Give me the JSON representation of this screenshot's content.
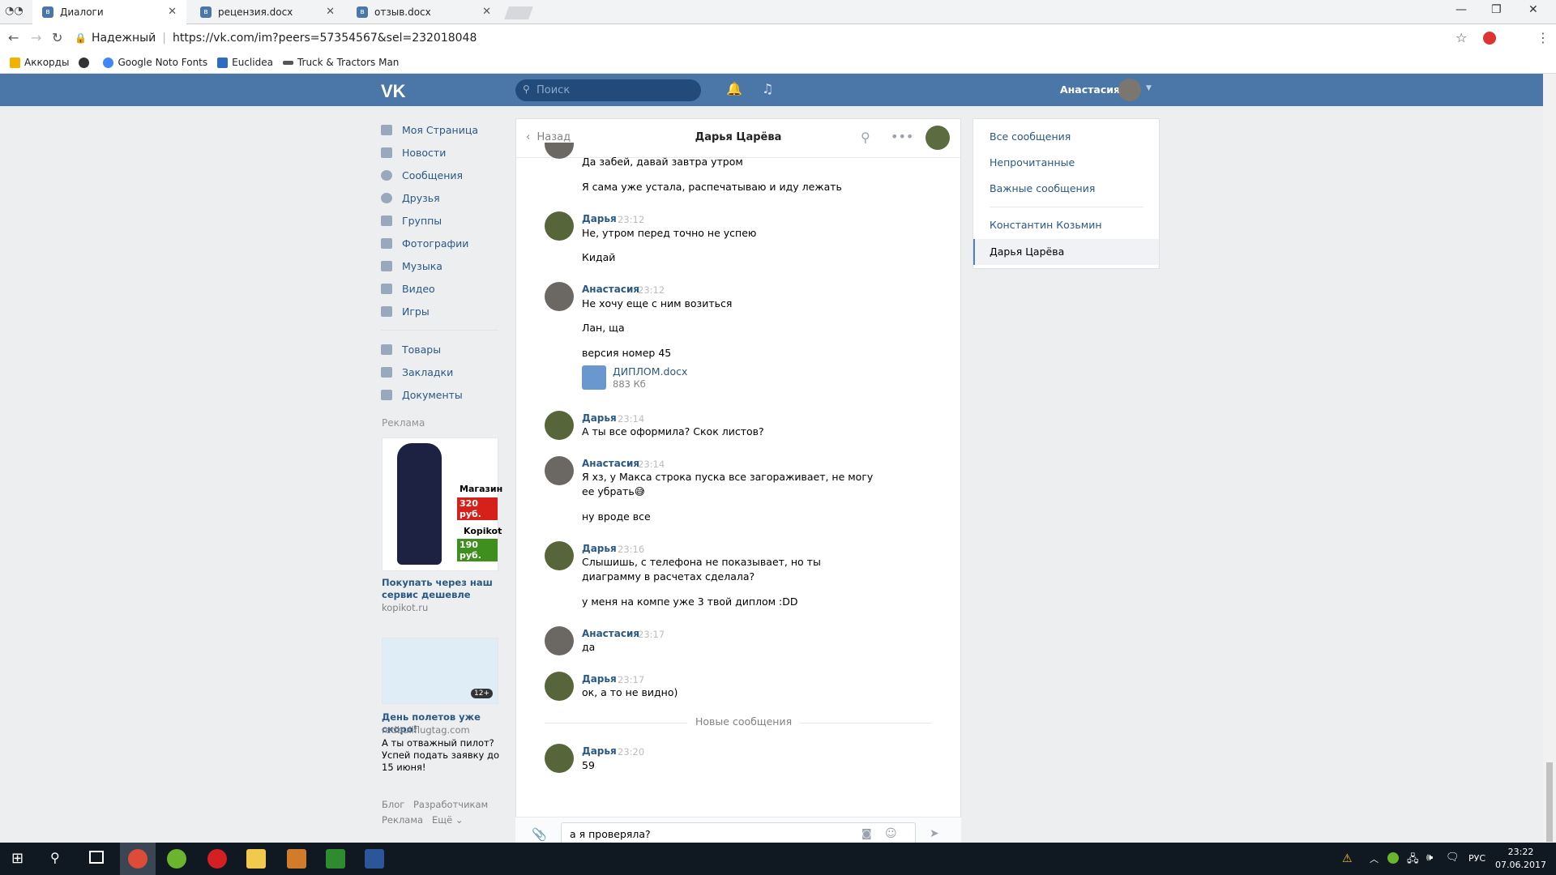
{
  "browser": {
    "tabs": [
      {
        "label": "Диалоги"
      },
      {
        "label": "рецензия.docx"
      },
      {
        "label": "отзыв.docx"
      }
    ],
    "secure_label": "Надежный",
    "url": "https://vk.com/im?peers=57354567&sel=232018048",
    "bookmarks": [
      {
        "label": "Аккорды"
      },
      {
        "label": ""
      },
      {
        "label": "Google Noto Fonts"
      },
      {
        "label": "Euclidea"
      },
      {
        "label": "Truck & Tractors Man"
      }
    ]
  },
  "header": {
    "logo": "VK",
    "search_placeholder": "Поиск",
    "user_name": "Анастасия"
  },
  "menu": [
    "Моя Страница",
    "Новости",
    "Сообщения",
    "Друзья",
    "Группы",
    "Фотографии",
    "Музыка",
    "Видео",
    "Игры",
    "Товары",
    "Закладки",
    "Документы"
  ],
  "ads": {
    "label": "Реклама",
    "ad1": {
      "shop1": "Магазин",
      "price1": "320 руб.",
      "shop2": "Kopikot",
      "price2": "190 руб.",
      "title": "Покупать через наш сервис дешевле",
      "domain": "kopikot.ru"
    },
    "ad2": {
      "age": "12+",
      "title": "День полетов уже скоро!",
      "domain": "redbullflugtag.com",
      "text": "А ты отважный пилот? Успей подать заявку до 15 июня!"
    }
  },
  "footer": {
    "blog": "Блог",
    "developers": "Разработчикам",
    "ads": "Реклама",
    "more": "Ещё ⌄"
  },
  "chat": {
    "back": "Назад",
    "peer": "Дарья Царёва",
    "messages": [
      {
        "name": "",
        "time": "",
        "lines": [
          "Да забей, давай завтра утром",
          "Я сама уже устала, распечатываю и иду лежать"
        ]
      },
      {
        "name": "Дарья",
        "time": "23:12",
        "lines": [
          "Не, утром перед точно не успею",
          "Кидай"
        ]
      },
      {
        "name": "Анастасия",
        "time": "23:12",
        "lines": [
          "Не хочу еще с ним возиться",
          "Лан, ща",
          "версия номер 45"
        ],
        "file": {
          "name": "ДИПЛОМ.docx",
          "size": "883 Кб"
        }
      },
      {
        "name": "Дарья",
        "time": "23:14",
        "lines": [
          "А ты все оформила? Скок листов?"
        ]
      },
      {
        "name": "Анастасия",
        "time": "23:14",
        "lines": [
          "Я хз, у Макса строка пуска все загораживает, не могу ее убрать😅",
          "ну вроде все"
        ]
      },
      {
        "name": "Дарья",
        "time": "23:16",
        "lines": [
          "Слышишь, с телефона не показывает, но ты диаграмму в расчетах сделала?",
          "у меня на компе уже 3 твой диплом :DD"
        ]
      },
      {
        "name": "Анастасия",
        "time": "23:17",
        "lines": [
          "да"
        ]
      },
      {
        "name": "Дарья",
        "time": "23:17",
        "lines": [
          "ок, а то не видно)"
        ]
      },
      {
        "name": "Дарья",
        "time": "23:20",
        "lines": [
          "59"
        ]
      }
    ],
    "new_messages_label": "Новые сообщения",
    "input_value": "а я проверяла?"
  },
  "right_panel": [
    "Все сообщения",
    "Непрочитанные",
    "Важные сообщения",
    "Константин Козьмин",
    "Дарья Царёва"
  ],
  "taskbar": {
    "lang": "РУС",
    "time": "23:22",
    "date": "07.06.2017"
  }
}
